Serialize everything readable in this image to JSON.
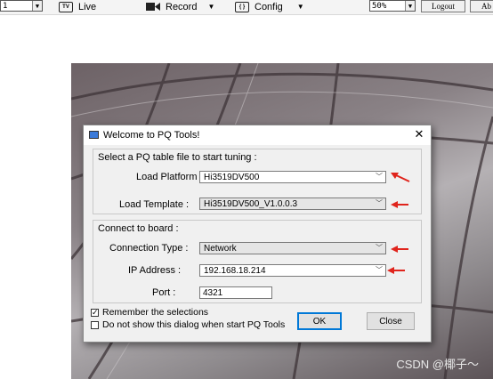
{
  "toolbar": {
    "channel_value": "1",
    "live_label": "Live",
    "record_label": "Record",
    "config_label": "Config",
    "zoom_value": "50%",
    "logout_label": "Logout",
    "about_label": "Ab"
  },
  "dialog": {
    "title": "Welcome to PQ Tools!",
    "group1_title": "Select a PQ table file to start tuning :",
    "load_platform_label": "Load Platform :",
    "load_platform_value": "Hi3519DV500",
    "load_template_label": "Load Template :",
    "load_template_value": "Hi3519DV500_V1.0.0.3",
    "group2_title": "Connect to board :",
    "connection_type_label": "Connection Type :",
    "connection_type_value": "Network",
    "ip_label": "IP Address :",
    "ip_value": "192.168.18.214",
    "port_label": "Port :",
    "port_value": "4321",
    "remember_label": "Remember the selections",
    "remember_checked": true,
    "dontshow_label": "Do not show this dialog when start PQ Tools",
    "dontshow_checked": false,
    "ok_label": "OK",
    "close_label": "Close"
  },
  "watermark": "CSDN @椰子～",
  "colors": {
    "arrow": "#e0241c",
    "accent": "#0078d7"
  }
}
